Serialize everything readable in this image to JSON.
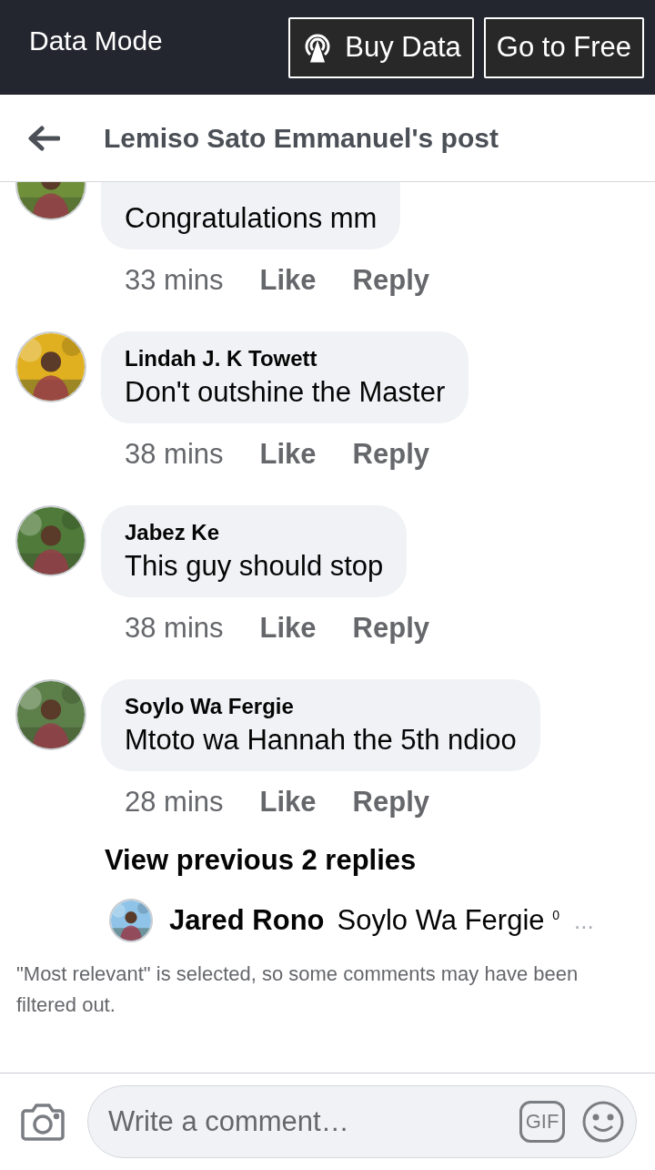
{
  "data_bar": {
    "label": "Data Mode",
    "buttons": [
      {
        "kind": "buy",
        "label": "Buy Data"
      },
      {
        "kind": "free",
        "label": "Go to Free"
      }
    ]
  },
  "header": {
    "title": "Lemiso Sato Emmanuel's post"
  },
  "comments": [
    {
      "text": "Congratulations mm",
      "time": "33 mins",
      "like": "Like",
      "reply": "Reply"
    },
    {
      "name": "Lindah J. K Towett",
      "text": "Don't outshine the Master",
      "time": "38 mins",
      "like": "Like",
      "reply": "Reply"
    },
    {
      "name": "Jabez Ke",
      "text": "This guy should stop",
      "time": "38 mins",
      "like": "Like",
      "reply": "Reply"
    },
    {
      "name": "Soylo Wa Fergie",
      "text": "Mtoto wa Hannah the 5th ndioo",
      "time": "28 mins",
      "like": "Like",
      "reply": "Reply"
    }
  ],
  "replies": {
    "link": "View previous 2 replies",
    "latest": {
      "name": "Jared Rono",
      "text": "Soylo Wa Fergie $^{0}$",
      "more": "..."
    }
  },
  "filter_note": "\"Most relevant\" is selected, so some comments may have been filtered out.",
  "composer": {
    "placeholder": "Write a comment…",
    "gif": "GIF"
  }
}
